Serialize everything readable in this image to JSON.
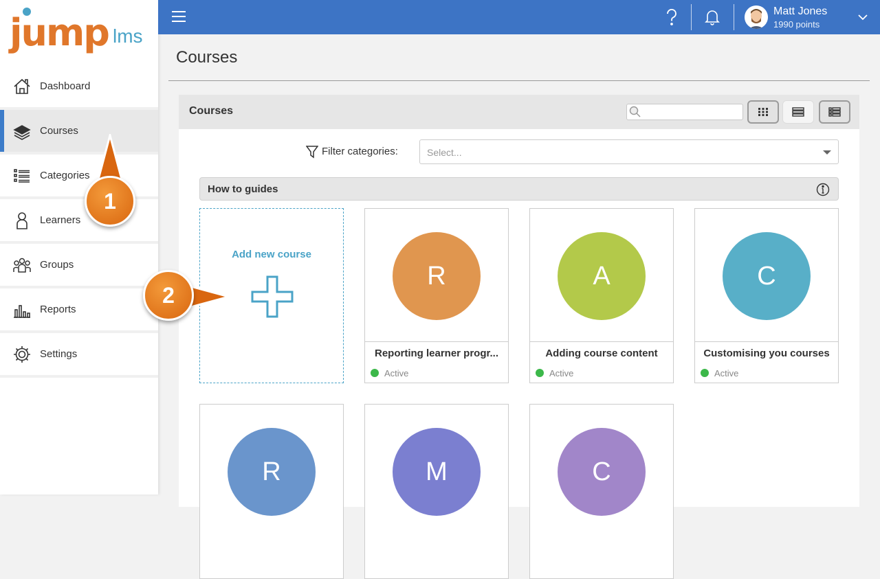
{
  "logo": {
    "jump": "jump",
    "lms": "lms"
  },
  "sidebar": {
    "items": [
      {
        "label": "Dashboard",
        "icon": "home-icon"
      },
      {
        "label": "Courses",
        "icon": "books-icon",
        "active": true
      },
      {
        "label": "Categories",
        "icon": "list-icon"
      },
      {
        "label": "Learners",
        "icon": "person-icon"
      },
      {
        "label": "Groups",
        "icon": "group-icon"
      },
      {
        "label": "Reports",
        "icon": "bar-chart-icon"
      },
      {
        "label": "Settings",
        "icon": "gear-icon"
      }
    ]
  },
  "topbar": {
    "user_name": "Matt Jones",
    "user_points": "1990 points",
    "colors": {
      "bar": "#3d74c5"
    }
  },
  "page": {
    "title": "Courses"
  },
  "panel": {
    "title": "Courses",
    "search_placeholder": "",
    "filter_label": "Filter categories:",
    "select_placeholder": "Select..."
  },
  "group": {
    "title": "How to guides"
  },
  "add_course": {
    "label": "Add new course"
  },
  "courses": [
    {
      "letter": "R",
      "name": "Reporting learner progr...",
      "status": "Active",
      "color": "#e0964f"
    },
    {
      "letter": "A",
      "name": "Adding course content",
      "status": "Active",
      "color": "#b3c94a"
    },
    {
      "letter": "C",
      "name": "Customising you courses",
      "status": "Active",
      "color": "#58afc8"
    },
    {
      "letter": "R",
      "name": "",
      "status": "",
      "color": "#6a95cc"
    },
    {
      "letter": "M",
      "name": "",
      "status": "",
      "color": "#7b7fd0"
    },
    {
      "letter": "C",
      "name": "",
      "status": "",
      "color": "#a186c9"
    }
  ],
  "callouts": [
    {
      "label": "1"
    },
    {
      "label": "2"
    }
  ],
  "status_color": "#3cb84a"
}
